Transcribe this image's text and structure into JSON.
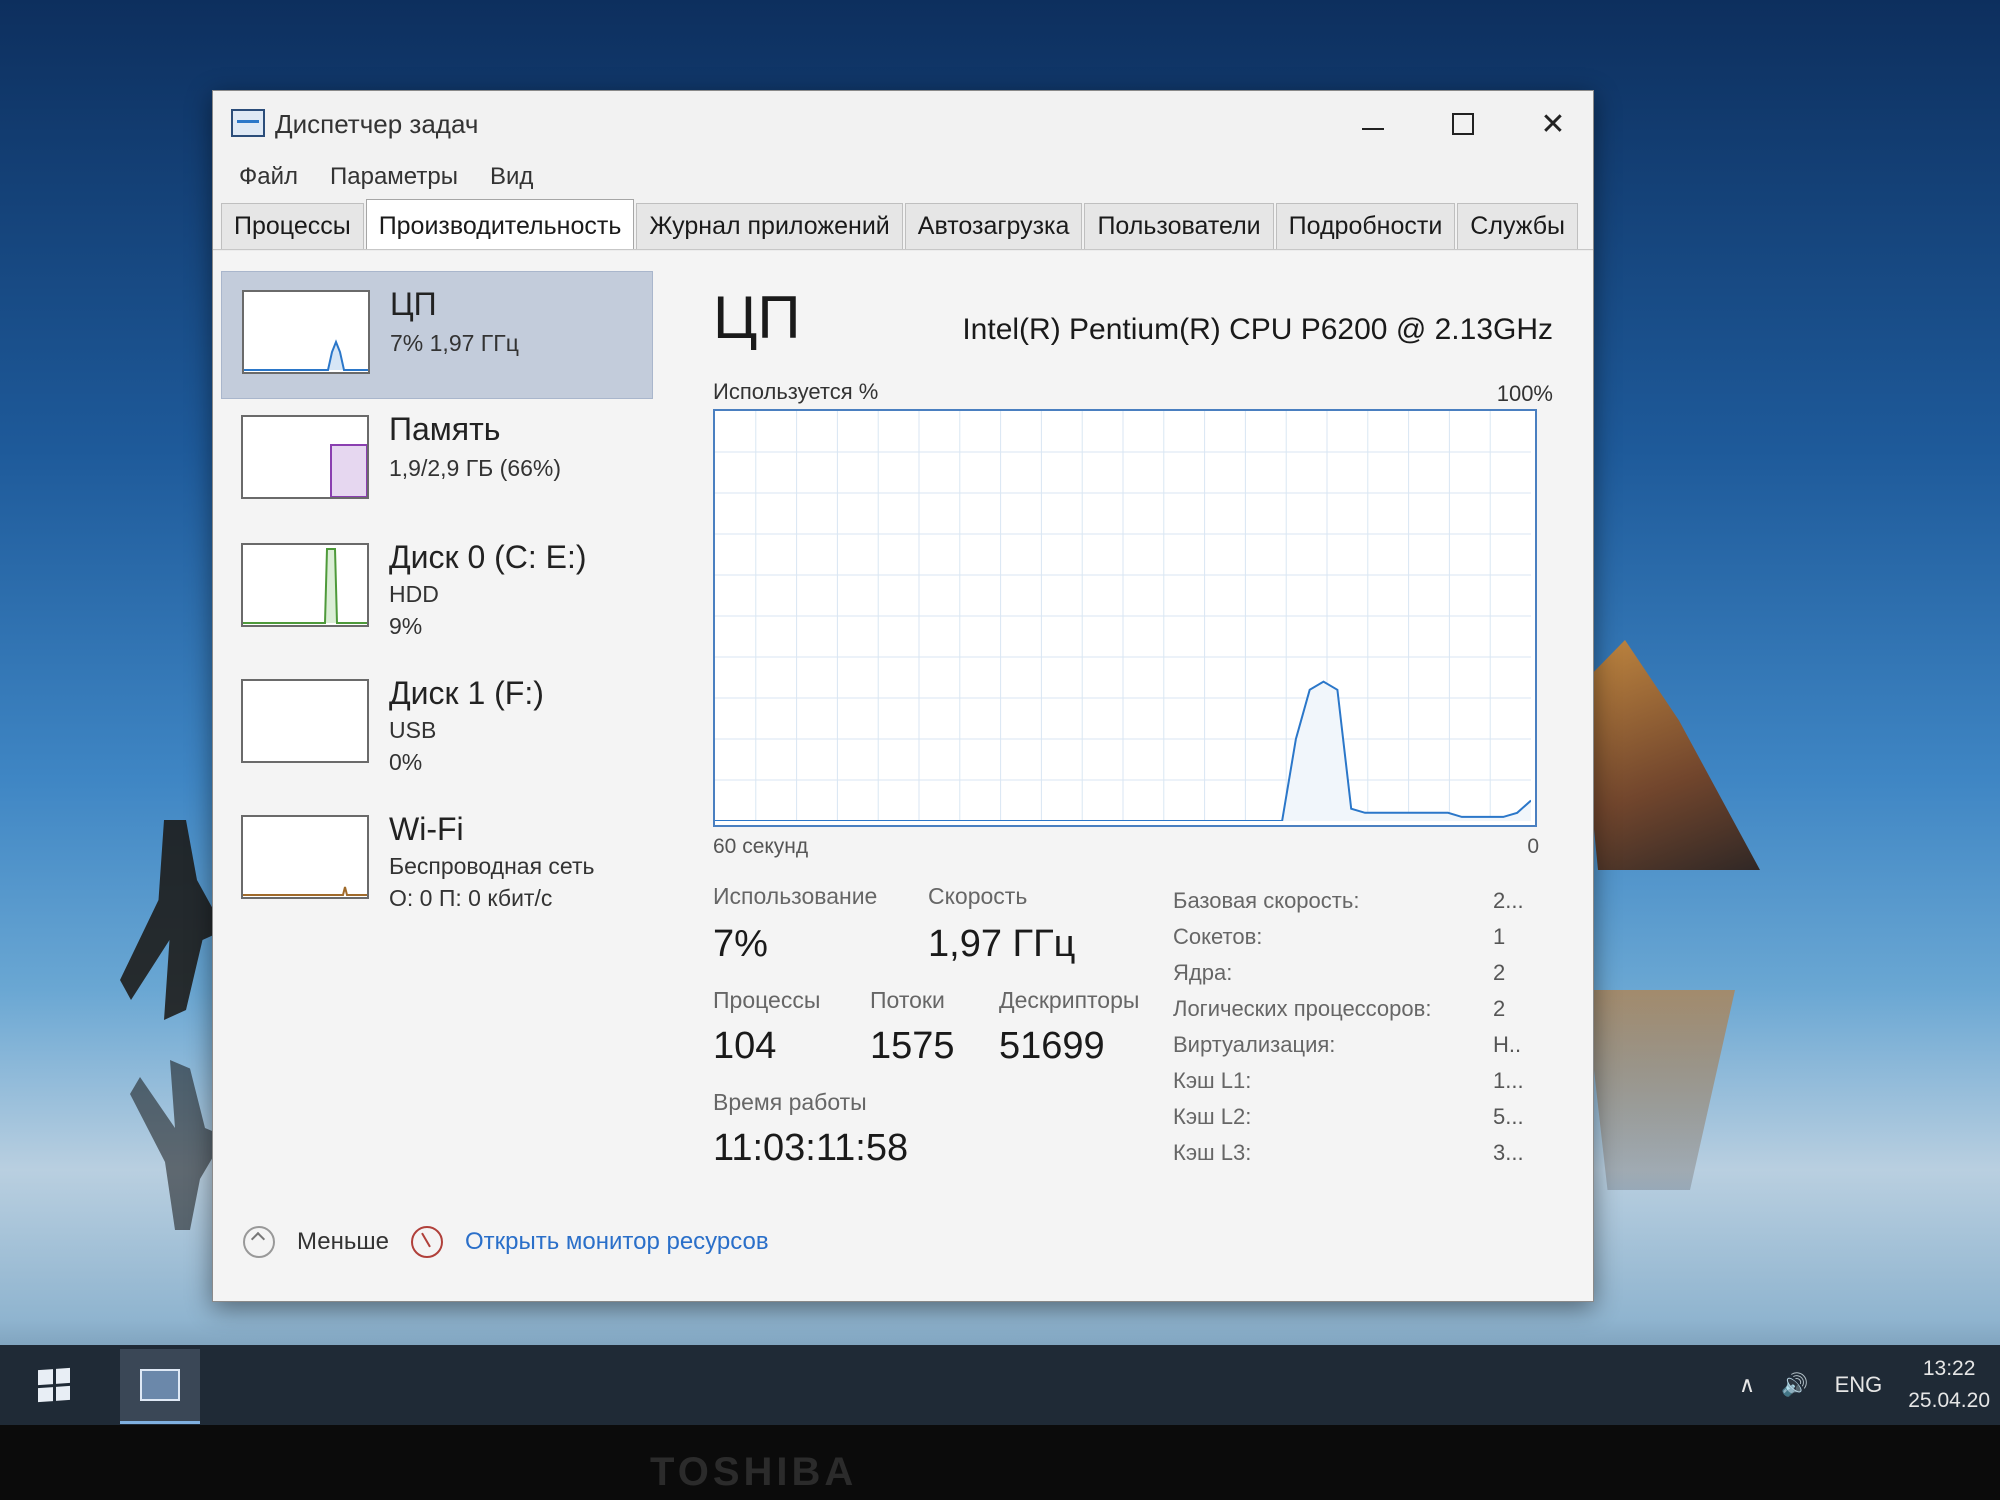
{
  "window": {
    "title": "Диспетчер задач",
    "controls": {
      "minimize": "—",
      "maximize": "",
      "close": "✕"
    }
  },
  "menu": [
    "Файл",
    "Параметры",
    "Вид"
  ],
  "tabs": [
    {
      "label": "Процессы",
      "active": false
    },
    {
      "label": "Производительность",
      "active": true
    },
    {
      "label": "Журнал приложений",
      "active": false
    },
    {
      "label": "Автозагрузка",
      "active": false
    },
    {
      "label": "Пользователи",
      "active": false
    },
    {
      "label": "Подробности",
      "active": false
    },
    {
      "label": "Службы",
      "active": false
    }
  ],
  "sidebar": {
    "items": [
      {
        "title": "ЦП",
        "sub": "7% 1,97 ГГц",
        "sub2": "",
        "active": true,
        "color": "#2b77c9"
      },
      {
        "title": "Память",
        "sub": "1,9/2,9 ГБ (66%)",
        "sub2": "",
        "active": false,
        "color": "#8a3fb0"
      },
      {
        "title": "Диск 0 (C: E:)",
        "sub": "HDD",
        "sub2": "9%",
        "active": false,
        "color": "#4e9a3a"
      },
      {
        "title": "Диск 1 (F:)",
        "sub": "USB",
        "sub2": "0%",
        "active": false,
        "color": "#4e9a3a"
      },
      {
        "title": "Wi-Fi",
        "sub": "Беспроводная сеть",
        "sub2": "О: 0 П: 0 кбит/с",
        "active": false,
        "color": "#a06a2a"
      }
    ]
  },
  "cpu": {
    "title": "ЦП",
    "model": "Intel(R) Pentium(R) CPU P6200 @ 2.13GHz",
    "graph_label": "Используется %",
    "graph_max": "100%",
    "axis_left": "60 секунд",
    "axis_right": "0",
    "usage_label": "Использование",
    "usage_value": "7%",
    "speed_label": "Скорость",
    "speed_value": "1,97 ГГц",
    "processes_label": "Процессы",
    "processes_value": "104",
    "threads_label": "Потоки",
    "threads_value": "1575",
    "handles_label": "Дескрипторы",
    "handles_value": "51699",
    "uptime_label": "Время работы",
    "uptime_value": "11:03:11:58",
    "info": [
      {
        "key": "Базовая скорость:",
        "val": "2..."
      },
      {
        "key": "Сокетов:",
        "val": "1"
      },
      {
        "key": "Ядра:",
        "val": "2"
      },
      {
        "key": "Логических процессоров:",
        "val": "2"
      },
      {
        "key": "Виртуализация:",
        "val": "Н.."
      },
      {
        "key": "Кэш L1:",
        "val": "1..."
      },
      {
        "key": "Кэш L2:",
        "val": "5..."
      },
      {
        "key": "Кэш L3:",
        "val": "3..."
      }
    ],
    "usage_history": [
      0,
      0,
      0,
      0,
      0,
      0,
      0,
      0,
      0,
      0,
      0,
      0,
      0,
      0,
      0,
      0,
      0,
      0,
      0,
      0,
      0,
      0,
      0,
      0,
      0,
      0,
      0,
      0,
      0,
      0,
      0,
      0,
      0,
      0,
      0,
      0,
      0,
      0,
      0,
      0,
      0,
      0,
      20,
      32,
      34,
      32,
      3,
      2,
      2,
      2,
      2,
      2,
      2,
      2,
      1,
      1,
      1,
      1,
      2,
      5
    ]
  },
  "footer": {
    "less_label": "Меньше",
    "monitor_link": "Открыть монитор ресурсов"
  },
  "taskbar": {
    "lang": "ENG",
    "time": "13:22",
    "date": "25.04.20",
    "tray_up": "∧",
    "volume": "🔊"
  },
  "bezel_brand": "TOSHIBA"
}
